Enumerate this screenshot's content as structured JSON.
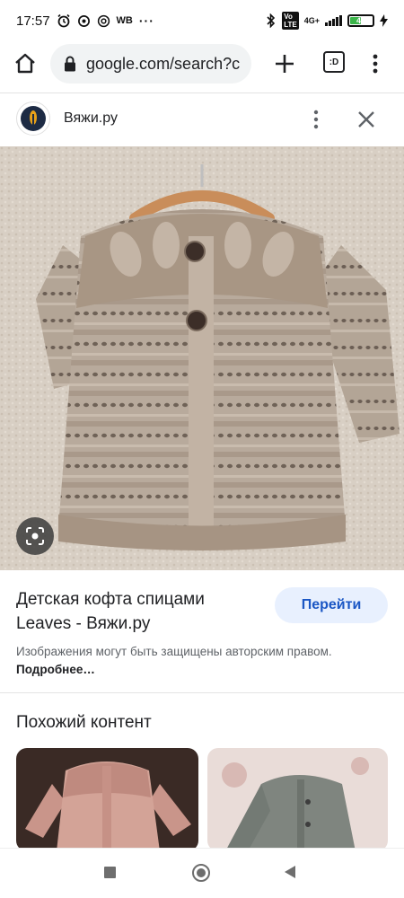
{
  "status_bar": {
    "time": "17:57",
    "carrier_tag": "WB",
    "network": "4G+",
    "battery_level": "46",
    "battery_fraction": 0.46
  },
  "browser": {
    "url": "google.com/search?c",
    "tab_count": ":D"
  },
  "source": {
    "name": "Вяжи.ру"
  },
  "result": {
    "title": "Детская кофта спицами Leaves - Вяжи.ру",
    "go_button": "Перейти",
    "copyright_text": "Изображения могут быть защищены авторским правом.",
    "more_link": "Подробнее…"
  },
  "similar": {
    "title": "Похожий контент"
  },
  "icons": {
    "home": "home-icon",
    "lock": "lock-icon",
    "plus": "plus-icon",
    "tabs": "tabs-icon",
    "menu": "more-vert-icon",
    "close": "close-icon",
    "lens": "lens-icon"
  },
  "colors": {
    "accent": "#1a56c4",
    "button_bg": "#e8f0fe",
    "battery": "#3bb54a"
  }
}
